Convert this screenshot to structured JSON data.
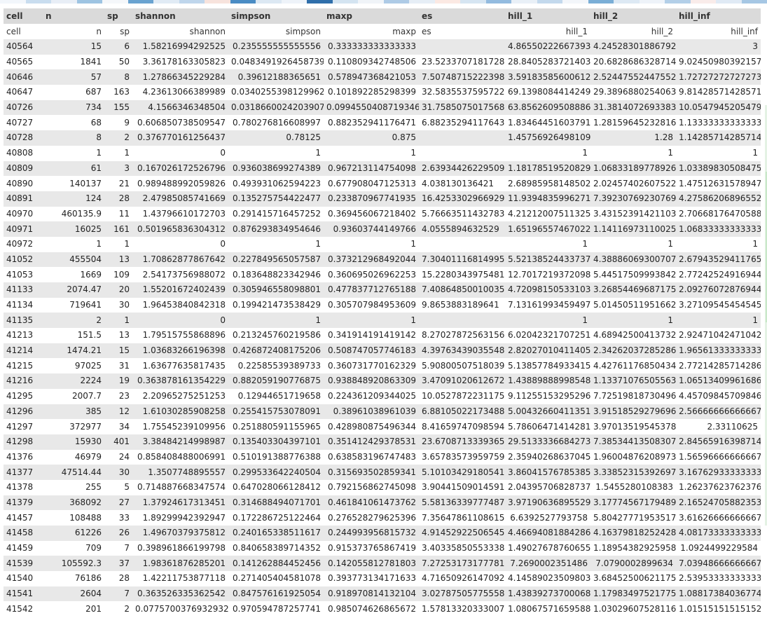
{
  "header_colors": [
    "#f2f6fb",
    "#c9ddef",
    "#e8eef6",
    "#9ec4e2",
    "#f5f7fa",
    "#6aa3d0",
    "#e1ebf5",
    "#bfd6ec",
    "#f7e3dd",
    "#4a8cc4",
    "#dce8f3",
    "#eef3f9",
    "#2f6eaa",
    "#d4e4f1",
    "#f0f4f8",
    "#aecbe6",
    "#e6eef6",
    "#fbe9e3",
    "#d6e5f2",
    "#93bbdf",
    "#e9f0f7",
    "#c3d9ed",
    "#f3f6fa",
    "#7aaed6",
    "#dde9f4",
    "#eef3f9",
    "#b3cfe8",
    "#f9ecea",
    "#e0eaf5",
    "#a6c7e4"
  ],
  "columns": [
    {
      "header": "cell",
      "sub": "cell",
      "sub_align": "l"
    },
    {
      "header": "n",
      "sub": "n",
      "sub_align": "r"
    },
    {
      "header": "sp",
      "sub": "sp",
      "sub_align": "r"
    },
    {
      "header": "shannon",
      "sub": "shannon",
      "sub_align": "r"
    },
    {
      "header": "simpson",
      "sub": "simpson",
      "sub_align": "r"
    },
    {
      "header": "maxp",
      "sub": "maxp",
      "sub_align": "r"
    },
    {
      "header": "es",
      "sub": "es",
      "sub_align": "l"
    },
    {
      "header": "hill_1",
      "sub": "hill_1",
      "sub_align": "r"
    },
    {
      "header": "hill_2",
      "sub": "hill_2",
      "sub_align": "r"
    },
    {
      "header": "hill_inf",
      "sub": "hill_inf",
      "sub_align": "r"
    }
  ],
  "rows": [
    [
      "40564",
      "15",
      "6",
      "1.58216994292525",
      "0.235555555555556",
      "0.333333333333333",
      "",
      "4.86550222667393",
      "4.24528301886792",
      "3"
    ],
    [
      "40565",
      "1841",
      "50",
      "3.36178163305823",
      "0.0483491926458739",
      "0.110809342748506",
      "23.5233707181728",
      "28.8405283721403",
      "20.6828686328714",
      "9.02450980392157"
    ],
    [
      "40646",
      "57",
      "8",
      "1.27866345229284",
      "0.39612188365651",
      "0.578947368421053",
      "7.50748715222398",
      "3.59183585600612",
      "2.52447552447552",
      "1.72727272727273"
    ],
    [
      "40647",
      "687",
      "163",
      "4.23613066389989",
      "0.0340255398129962",
      "0.101892285298399",
      "32.5835537595722",
      "69.1398084414249",
      "29.3896880254063",
      "9.81428571428571"
    ],
    [
      "40726",
      "734",
      "155",
      "4.1566346348504",
      "0.0318660024203907",
      "0.0994550408719346",
      "31.7585075017568",
      "63.8562609508886",
      "31.3814072693383",
      "10.0547945205479"
    ],
    [
      "40727",
      "68",
      "9",
      "0.606850738509547",
      "0.780276816608997",
      "0.882352941176471",
      "6.88235294117643",
      "1.83464451603791",
      "1.28159645232816",
      "1.13333333333333"
    ],
    [
      "40728",
      "8",
      "2",
      "0.376770161256437",
      "0.78125",
      "0.875",
      "",
      "1.45756926498109",
      "1.28",
      "1.14285714285714"
    ],
    [
      "40808",
      "1",
      "1",
      "0",
      "1",
      "1",
      "",
      "1",
      "1",
      "1"
    ],
    [
      "40809",
      "61",
      "3",
      "0.167026172526796",
      "0.936038699274389",
      "0.967213114754098",
      "2.63934426229509",
      "1.18178519520829",
      "1.06833189778926",
      "1.03389830508475"
    ],
    [
      "40890",
      "140137",
      "21",
      "0.989488992059826",
      "0.493931062594223",
      "0.677908047125313",
      "4.038130136421",
      "2.68985958148502",
      "2.02457402607522",
      "1.47512631578947"
    ],
    [
      "40891",
      "124",
      "28",
      "2.47985085741669",
      "0.135275754422477",
      "0.233870967741935",
      "16.4253302966929",
      "11.9394835996271",
      "7.39230769230769",
      "4.27586206896552"
    ],
    [
      "40970",
      "460135.9",
      "11",
      "1.43796610172703",
      "0.291415716457252",
      "0.369456067218402",
      "5.76663511432783",
      "4.21212007511325",
      "3.43152391421103",
      "2.70668176470588"
    ],
    [
      "40971",
      "16025",
      "161",
      "0.501965836304312",
      "0.876293834954646",
      "0.93603744149766",
      "4.0555894632529",
      "1.65196557467022",
      "1.14116973110025",
      "1.06833333333333"
    ],
    [
      "40972",
      "1",
      "1",
      "0",
      "1",
      "1",
      "",
      "1",
      "1",
      "1"
    ],
    [
      "41052",
      "455504",
      "13",
      "1.70862877867642",
      "0.227849565057587",
      "0.373212968492044",
      "7.30401116814995",
      "5.52138524433737",
      "4.38886069300707",
      "2.67943529411765"
    ],
    [
      "41053",
      "1669",
      "109",
      "2.54173756988072",
      "0.183648823342946",
      "0.360695026962253",
      "15.2280343975481",
      "12.7017219372098",
      "5.44517509993842",
      "2.77242524916944"
    ],
    [
      "41133",
      "2074.47",
      "20",
      "1.55201672402439",
      "0.305946558098801",
      "0.477837712765188",
      "7.40864850010035",
      "4.72098150533103",
      "3.26854469687175",
      "2.09276072876944"
    ],
    [
      "41134",
      "719641",
      "30",
      "1.96453840842318",
      "0.199421473538429",
      "0.305707984953609",
      "9.8653883189641",
      "7.13161993459497",
      "5.01450511951662",
      "3.27109545454545"
    ],
    [
      "41135",
      "2",
      "1",
      "0",
      "1",
      "1",
      "",
      "1",
      "1",
      "1"
    ],
    [
      "41213",
      "151.5",
      "13",
      "1.79515755868896",
      "0.213245760219586",
      "0.341914191419142",
      "8.27027872563156",
      "6.02042321707251",
      "4.68942500413732",
      "2.92471042471042"
    ],
    [
      "41214",
      "1474.21",
      "15",
      "1.03683266196398",
      "0.426872408175206",
      "0.508747057746183",
      "4.39763439035548",
      "2.82027010411405",
      "2.34262037285286",
      "1.96561333333333"
    ],
    [
      "41215",
      "97025",
      "31",
      "1.63677635817435",
      "0.22585539389733",
      "0.360731770162329",
      "5.90800507518039",
      "5.13857784933415",
      "4.42761176850434",
      "2.77214285714286"
    ],
    [
      "41216",
      "2224",
      "19",
      "0.363878161354229",
      "0.882059190776875",
      "0.938848920863309",
      "3.47091020612672",
      "1.43889888998548",
      "1.13371076505563",
      "1.06513409961686"
    ],
    [
      "41295",
      "2007.7",
      "23",
      "2.20965275251253",
      "0.12944651719658",
      "0.224361209344025",
      "10.0527872231175",
      "9.11255153295296",
      "7.72519818730496",
      "4.45709845709846"
    ],
    [
      "41296",
      "385",
      "12",
      "1.61030285908258",
      "0.255415753078091",
      "0.38961038961039",
      "6.88105022173488",
      "5.00432660411351",
      "3.91518529279696",
      "2.56666666666667"
    ],
    [
      "41297",
      "372977",
      "34",
      "1.75545239109956",
      "0.251880591155965",
      "0.428980875496344",
      "8.41659747098594",
      "5.78606471414281",
      "3.97013519545378",
      "2.33110625"
    ],
    [
      "41298",
      "15930",
      "401",
      "3.38484214998987",
      "0.135403304397101",
      "0.351412429378531",
      "23.6708713339365",
      "29.5133336684273",
      "7.38534413508307",
      "2.84565916398714"
    ],
    [
      "41376",
      "46979",
      "24",
      "0.858408488006991",
      "0.510191388776388",
      "0.638583196747483",
      "3.65783573959759",
      "2.35940268637045",
      "1.96004876208973",
      "1.56596666666667"
    ],
    [
      "41377",
      "47514.44",
      "30",
      "1.3507748895557",
      "0.299533642240504",
      "0.315693502859341",
      "5.10103429180541",
      "3.86041576785385",
      "3.33852315392697",
      "3.16762933333333"
    ],
    [
      "41378",
      "255",
      "5",
      "0.714887668347574",
      "0.647028066128412",
      "0.792156862745098",
      "3.90441509014591",
      "2.04395706828737",
      "1.5455280108383",
      "1.26237623762376"
    ],
    [
      "41379",
      "368092",
      "27",
      "1.37924617313451",
      "0.314688494071701",
      "0.461841061473762",
      "5.58136339777487",
      "3.97190636895529",
      "3.17774567179489",
      "2.16524705882353"
    ],
    [
      "41457",
      "108488",
      "33",
      "1.89299942392947",
      "0.172286725122464",
      "0.276528279625396",
      "7.35647861108615",
      "6.6392527793758",
      "5.80427771953517",
      "3.61626666666667"
    ],
    [
      "41458",
      "61226",
      "26",
      "1.49670379375812",
      "0.240165338511617",
      "0.244993956815732",
      "4.91452922506545",
      "4.46694081884286",
      "4.16379818252428",
      "4.08173333333333"
    ],
    [
      "41459",
      "709",
      "7",
      "0.398961866199798",
      "0.840658389714352",
      "0.915373765867419",
      "3.40335850553338",
      "1.49027678760655",
      "1.18954382925958",
      "1.0924499229584"
    ],
    [
      "41539",
      "105592.3",
      "37",
      "1.98361876285201",
      "0.141262884452456",
      "0.142055812781803",
      "7.27253173177781",
      "7.2690002351486",
      "7.0790002899634",
      "7.03948666666667"
    ],
    [
      "41540",
      "76186",
      "28",
      "1.42211753877118",
      "0.271405404581078",
      "0.393773134171633",
      "4.71650926147092",
      "4.14589023509803",
      "3.68452500621175",
      "2.53953333333333"
    ],
    [
      "41541",
      "2604",
      "7",
      "0.363526335362542",
      "0.847576161925054",
      "0.918970814132104",
      "3.02787505775558",
      "1.43839273700068",
      "1.17983497521775",
      "1.08817384036774"
    ],
    [
      "41542",
      "201",
      "2",
      "0.0775700376932932",
      "0.970594787257741",
      "0.985074626865672",
      "1.57813320333007",
      "1.08067571659588",
      "1.03029607528116",
      "1.01515151515152"
    ]
  ]
}
